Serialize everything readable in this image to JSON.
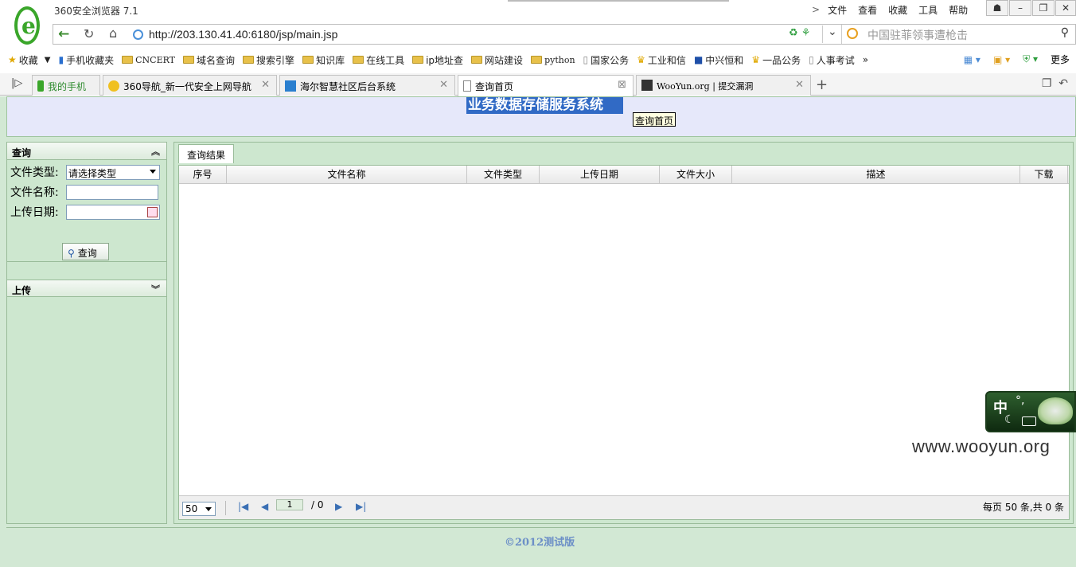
{
  "browser": {
    "app_title": "360安全浏览器 7.1",
    "menu": [
      "文件",
      "查看",
      "收藏",
      "工具",
      "帮助"
    ],
    "url": "http://203.130.41.40:6180/jsp/main.jsp",
    "search_placeholder": "中国驻菲领事遭枪击",
    "bookmarks": [
      "收藏",
      "手机收藏夹",
      "CNCERT",
      "域名查询",
      "搜索引擎",
      "知识库",
      "在线工具",
      "ip地址查",
      "网站建设",
      "python",
      "国家公务",
      "工业和信",
      "中兴恒和",
      "一品公务",
      "人事考试"
    ],
    "bookmark_more": "更多",
    "tabs": [
      {
        "label": "我的手机"
      },
      {
        "label": "360导航_新一代安全上网导航"
      },
      {
        "label": "海尔智慧社区后台系统"
      },
      {
        "label": "查询首页"
      },
      {
        "label": "WooYun.org | 提交漏洞"
      }
    ]
  },
  "page": {
    "site_title": "业务数据存储服务系统",
    "tooltip": "查询首页",
    "query_panel": {
      "title": "查询",
      "file_type_label": "文件类型:",
      "file_type_value": "请选择类型",
      "file_name_label": "文件名称:",
      "upload_date_label": "上传日期:",
      "query_button": "查询"
    },
    "upload_panel": {
      "title": "上传"
    },
    "result_tab": "查询结果",
    "grid": {
      "columns": [
        "序号",
        "文件名称",
        "文件类型",
        "上传日期",
        "文件大小",
        "描述",
        "下载"
      ]
    },
    "pager": {
      "page_size": "50",
      "current_page": "1",
      "total_pages": "/ 0",
      "info": "每页 50 条,共 0 条"
    },
    "copyright": "©2012测试版",
    "watermark": "www.wooyun.org"
  },
  "ime": {
    "char": "中",
    "punct": "°,"
  }
}
